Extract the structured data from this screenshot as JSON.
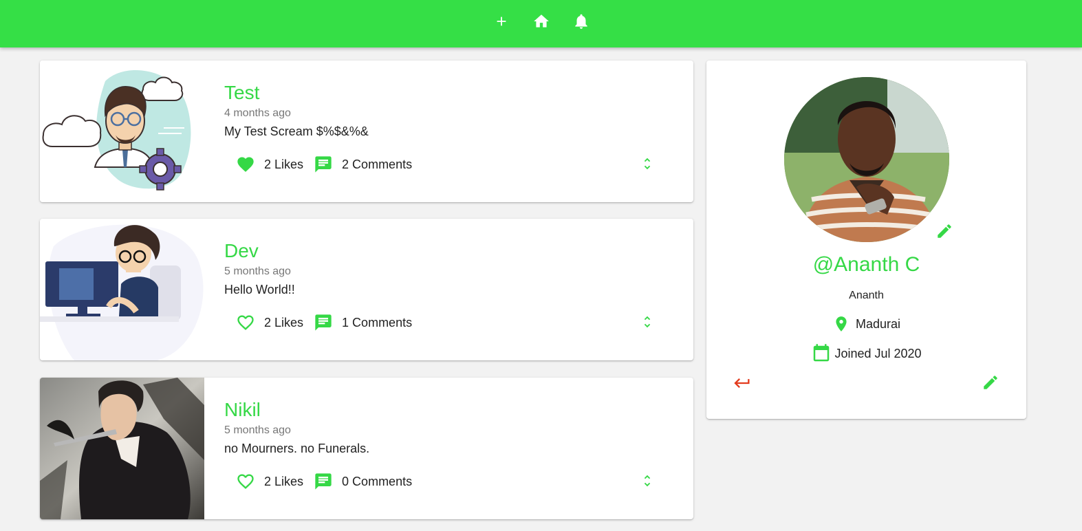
{
  "colors": {
    "accent": "#35df46",
    "accent_text": "#35d846",
    "logout": "#e33b1e"
  },
  "navbar": {
    "icons": [
      "add-icon",
      "home-icon",
      "notifications-icon"
    ]
  },
  "posts": [
    {
      "user": "Test",
      "time": "4 months ago",
      "body": "My Test Scream $%$&%&",
      "likes": "2 Likes",
      "comments": "2 Comments",
      "liked": true
    },
    {
      "user": "Dev",
      "time": "5 months ago",
      "body": "Hello World!!",
      "likes": "2 Likes",
      "comments": "1 Comments",
      "liked": false
    },
    {
      "user": "Nikil",
      "time": "5 months ago",
      "body": "no Mourners. no Funerals.",
      "likes": "2 Likes",
      "comments": "0 Comments",
      "liked": false
    }
  ],
  "profile": {
    "handle": "@Ananth C",
    "bio": "Ananth",
    "location": "Madurai",
    "joined": "Joined Jul 2020"
  }
}
